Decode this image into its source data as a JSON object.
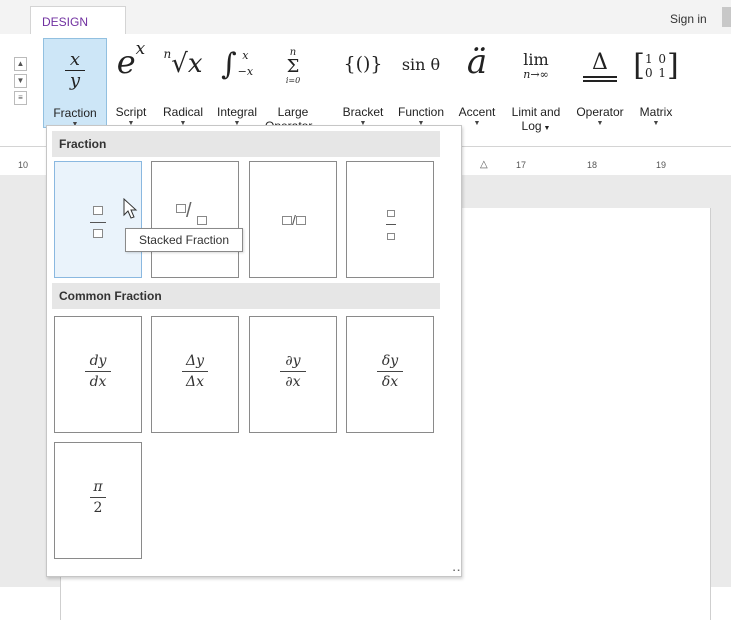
{
  "tabs": {
    "active": "DESIGN",
    "sign_in": "Sign in"
  },
  "ribbon": {
    "buttons": [
      {
        "key": "fraction",
        "label": "Fraction"
      },
      {
        "key": "script",
        "label": "Script"
      },
      {
        "key": "radical",
        "label": "Radical"
      },
      {
        "key": "integral",
        "label": "Integral"
      },
      {
        "key": "large_operator",
        "label": "Large",
        "label2": "Operator"
      },
      {
        "key": "bracket",
        "label": "Bracket"
      },
      {
        "key": "function",
        "label": "Function"
      },
      {
        "key": "accent",
        "label": "Accent"
      },
      {
        "key": "limit_log",
        "label": "Limit and",
        "label2": "Log"
      },
      {
        "key": "operator",
        "label": "Operator"
      },
      {
        "key": "matrix",
        "label": "Matrix"
      }
    ],
    "glyphs": {
      "fraction_num": "x",
      "fraction_den": "y",
      "script": "e",
      "script_sup": "x",
      "radical_index": "n",
      "radical_body": "√x",
      "integral": "∫",
      "integral_sup": "x",
      "integral_sub": "−x",
      "sum_top": "n",
      "sum": "Σ",
      "sum_bot": "i=0",
      "bracket": "{()}",
      "function": "sin θ",
      "accent": "ä",
      "lim": "lim",
      "lim_sub": "n→∞",
      "operator": "Δ",
      "matrix_r1": "1 0",
      "matrix_r2": "0 1"
    }
  },
  "ruler": {
    "left_num": "10",
    "marks": [
      "17",
      "18",
      "19"
    ]
  },
  "gallery": {
    "section_fraction": "Fraction",
    "section_common": "Common Fraction",
    "tooltip": "Stacked Fraction",
    "common": [
      {
        "num": "dy",
        "den": "dx"
      },
      {
        "num": "Δy",
        "den": "Δx"
      },
      {
        "num": "∂y",
        "den": "∂x"
      },
      {
        "num": "δy",
        "den": "δx"
      },
      {
        "num": "π",
        "den": "2"
      }
    ]
  },
  "colors": {
    "accent": "#7030a0",
    "highlight": "#cde6f7"
  }
}
